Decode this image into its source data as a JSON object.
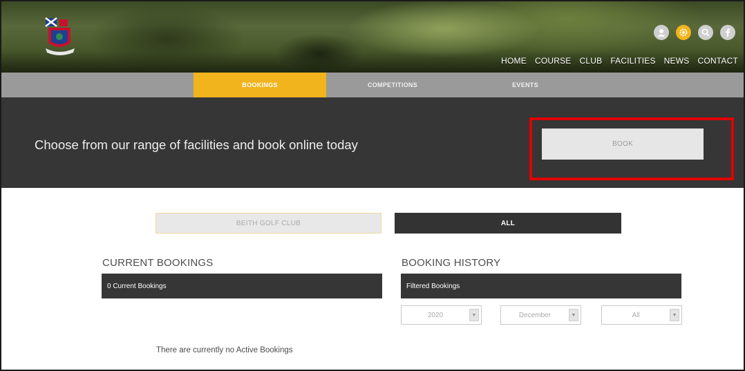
{
  "header": {
    "social_icons": [
      "user-icon",
      "settings-icon",
      "search-icon",
      "facebook-icon"
    ],
    "nav": [
      "HOME",
      "COURSE",
      "CLUB",
      "FACILITIES",
      "NEWS",
      "CONTACT"
    ],
    "accent_color": "#f1b41d"
  },
  "tabs": {
    "items": [
      "BOOKINGS",
      "COMPETITIONS",
      "EVENTS"
    ],
    "active": "BOOKINGS"
  },
  "banner": {
    "text": "Choose from our range of facilities and book online today",
    "book_label": "BOOK"
  },
  "filters": {
    "club_label": "BEITH GOLF CLUB",
    "all_label": "ALL"
  },
  "current": {
    "title": "CURRENT BOOKINGS",
    "bar_label": "0 Current Bookings",
    "empty_message": "There are currently no Active Bookings"
  },
  "history": {
    "title": "BOOKING HISTORY",
    "bar_label": "Filtered Bookings",
    "year": "2020",
    "month": "December",
    "type": "All"
  }
}
